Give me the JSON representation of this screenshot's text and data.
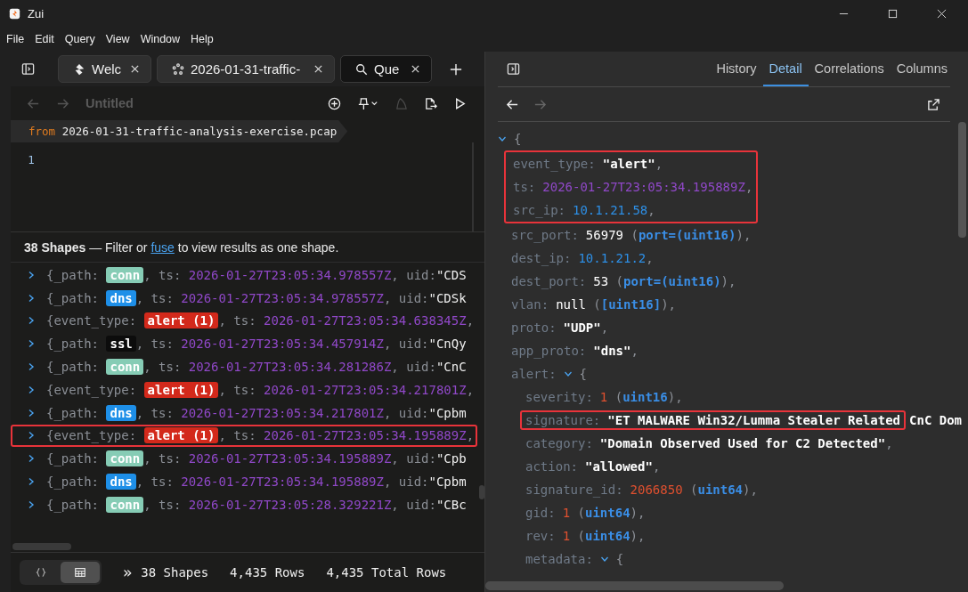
{
  "window": {
    "title": "Zui"
  },
  "menu": [
    "File",
    "Edit",
    "Query",
    "View",
    "Window",
    "Help"
  ],
  "tabs": [
    {
      "label": "Welc",
      "selected": false
    },
    {
      "label": "2026-01-31-traffic-",
      "selected": false
    },
    {
      "label": "Que",
      "selected": true
    }
  ],
  "editor": {
    "title": "Untitled",
    "from": "from",
    "source": "2026-01-31-traffic-analysis-exercise.pcap",
    "line_numbers": [
      "1"
    ]
  },
  "results": {
    "message_pre": "**38 Shapes** — Filter or ",
    "link": "fuse",
    "message_post": " to view results as one shape.",
    "rows": [
      {
        "key": "{_path:",
        "tag": "conn",
        "color": "#86ccb5",
        "pre": ", ts:",
        "ts": "2026-01-27T23:05:34.978557Z",
        "post": ", uid:",
        "uid": "\"CDS",
        "highlighted": false
      },
      {
        "key": "{_path:",
        "tag": "dns",
        "color": "#1e8fe8",
        "pre": ", ts:",
        "ts": "2026-01-27T23:05:34.978557Z",
        "post": ", uid:",
        "uid": "\"CDSk",
        "highlighted": false
      },
      {
        "key": "{event_type:",
        "tag": "alert (1)",
        "color": "#d3291b",
        "pre": ", ts:",
        "ts": "2026-01-27T23:05:34.638345Z",
        "post": ",",
        "highlighted": false
      },
      {
        "key": "{_path:",
        "tag": "ssl",
        "color": "#0c0c0c",
        "pre": ", ts:",
        "ts": "2026-01-27T23:05:34.457914Z",
        "post": ", uid:",
        "uid": "\"CnQy",
        "highlighted": false
      },
      {
        "key": "{_path:",
        "tag": "conn",
        "color": "#86ccb5",
        "pre": ", ts:",
        "ts": "2026-01-27T23:05:34.281286Z",
        "post": ", uid:",
        "uid": "\"CnC",
        "highlighted": false
      },
      {
        "key": "{event_type:",
        "tag": "alert (1)",
        "color": "#d3291b",
        "pre": ", ts:",
        "ts": "2026-01-27T23:05:34.217801Z",
        "post": ",",
        "highlighted": false
      },
      {
        "key": "{_path:",
        "tag": "dns",
        "color": "#1e8fe8",
        "pre": ", ts:",
        "ts": "2026-01-27T23:05:34.217801Z",
        "post": ", uid:",
        "uid": "\"Cpbm",
        "highlighted": false
      },
      {
        "key": "{event_type:",
        "tag": "alert (1)",
        "color": "#d3291b",
        "pre": ", ts:",
        "ts": "2026-01-27T23:05:34.195889Z",
        "post": ",",
        "highlighted": true
      },
      {
        "key": "{_path:",
        "tag": "conn",
        "color": "#86ccb5",
        "pre": ", ts:",
        "ts": "2026-01-27T23:05:34.195889Z",
        "post": ", uid:",
        "uid": "\"Cpb",
        "highlighted": false
      },
      {
        "key": "{_path:",
        "tag": "dns",
        "color": "#1e8fe8",
        "pre": ", ts:",
        "ts": "2026-01-27T23:05:34.195889Z",
        "post": ", uid:",
        "uid": "\"Cpbm",
        "highlighted": false
      },
      {
        "key": "{_path:",
        "tag": "conn",
        "color": "#86ccb5",
        "pre": ", ts:",
        "ts": "2026-01-27T23:05:28.329221Z",
        "post": ", uid:",
        "uid": "\"CBc",
        "highlighted": false
      }
    ]
  },
  "status_bar": {
    "views": [
      {
        "selected": false
      },
      {
        "selected": true
      }
    ],
    "expand": "»",
    "shapes": "38 Shapes",
    "rows": "4,435 Rows",
    "total": "4,435 Total Rows"
  },
  "detail": {
    "tabs": [
      {
        "label": "History",
        "selected": false
      },
      {
        "label": "Detail",
        "selected": true
      },
      {
        "label": "Correlations",
        "selected": false
      },
      {
        "label": "Columns",
        "selected": false
      }
    ],
    "root": {
      "brace": "{",
      "expanded": true,
      "children": [
        {
          "kind": "group",
          "highlighted": true,
          "children": [
            {
              "kind": "field",
              "key": "event_type:",
              "tokens": [
                {
                  "text": "\"alert\"",
                  "kind": "str"
                },
                {
                  "text": ",",
                  "kind": "punct"
                }
              ]
            },
            {
              "kind": "field",
              "key": "ts:",
              "tokens": [
                {
                  "text": "2026-01-27T23:05:34.195889Z",
                  "kind": "ts"
                },
                {
                  "text": ",",
                  "kind": "punct"
                }
              ]
            },
            {
              "kind": "field",
              "key": "src_ip:",
              "tokens": [
                {
                  "text": "10.1.21.58",
                  "kind": "ip"
                },
                {
                  "text": ",",
                  "kind": "punct"
                }
              ]
            }
          ]
        },
        {
          "kind": "field",
          "key": "src_port:",
          "tokens": [
            {
              "text": "56979",
              "kind": "num"
            },
            {
              "text": " (",
              "kind": "punct"
            },
            {
              "text": "port=(uint16)",
              "kind": "type"
            },
            {
              "text": "),",
              "kind": "punct"
            }
          ]
        },
        {
          "kind": "field",
          "key": "dest_ip:",
          "tokens": [
            {
              "text": "10.1.21.2",
              "kind": "ip"
            },
            {
              "text": ",",
              "kind": "punct"
            }
          ]
        },
        {
          "kind": "field",
          "key": "dest_port:",
          "tokens": [
            {
              "text": "53",
              "kind": "num"
            },
            {
              "text": " (",
              "kind": "punct"
            },
            {
              "text": "port=(uint16)",
              "kind": "type"
            },
            {
              "text": "),",
              "kind": "punct"
            }
          ]
        },
        {
          "kind": "field",
          "key": "vlan:",
          "tokens": [
            {
              "text": "null",
              "kind": "num"
            },
            {
              "text": " (",
              "kind": "punct"
            },
            {
              "text": "[uint16]",
              "kind": "type"
            },
            {
              "text": "),",
              "kind": "punct"
            }
          ]
        },
        {
          "kind": "field",
          "key": "proto:",
          "tokens": [
            {
              "text": "\"UDP\"",
              "kind": "str"
            },
            {
              "text": ",",
              "kind": "punct"
            }
          ]
        },
        {
          "kind": "field",
          "key": "app_proto:",
          "tokens": [
            {
              "text": "\"dns\"",
              "kind": "str"
            },
            {
              "text": ",",
              "kind": "punct"
            }
          ]
        },
        {
          "kind": "object",
          "key": "alert:",
          "brace": "{",
          "expanded": true,
          "children": [
            {
              "kind": "field",
              "key": "severity:",
              "tokens": [
                {
                  "text": "1",
                  "kind": "red"
                },
                {
                  "text": " (",
                  "kind": "punct"
                },
                {
                  "text": "uint16",
                  "kind": "type"
                },
                {
                  "text": "),",
                  "kind": "punct"
                }
              ]
            },
            {
              "kind": "field",
              "key": "signature:",
              "highlighted": true,
              "tokens": [
                {
                  "text": "\"ET MALWARE Win32/Lumma Stealer Related",
                  "kind": "str"
                }
              ],
              "tail": "CnC Dom"
            },
            {
              "kind": "field",
              "key": "category:",
              "tokens": [
                {
                  "text": "\"Domain Observed Used for C2 Detected\"",
                  "kind": "str"
                },
                {
                  "text": ",",
                  "kind": "punct"
                }
              ]
            },
            {
              "kind": "field",
              "key": "action:",
              "tokens": [
                {
                  "text": "\"allowed\"",
                  "kind": "str"
                },
                {
                  "text": ",",
                  "kind": "punct"
                }
              ]
            },
            {
              "kind": "field",
              "key": "signature_id:",
              "tokens": [
                {
                  "text": "2066850",
                  "kind": "red"
                },
                {
                  "text": " (",
                  "kind": "punct"
                },
                {
                  "text": "uint64",
                  "kind": "type"
                },
                {
                  "text": "),",
                  "kind": "punct"
                }
              ]
            },
            {
              "kind": "field",
              "key": "gid:",
              "tokens": [
                {
                  "text": "1",
                  "kind": "red"
                },
                {
                  "text": " (",
                  "kind": "punct"
                },
                {
                  "text": "uint64",
                  "kind": "type"
                },
                {
                  "text": "),",
                  "kind": "punct"
                }
              ]
            },
            {
              "kind": "field",
              "key": "rev:",
              "tokens": [
                {
                  "text": "1",
                  "kind": "red"
                },
                {
                  "text": " (",
                  "kind": "punct"
                },
                {
                  "text": "uint64",
                  "kind": "type"
                },
                {
                  "text": "),",
                  "kind": "punct"
                }
              ]
            },
            {
              "kind": "object",
              "key": "metadata:",
              "brace": "{",
              "expanded": true
            }
          ]
        }
      ]
    }
  }
}
